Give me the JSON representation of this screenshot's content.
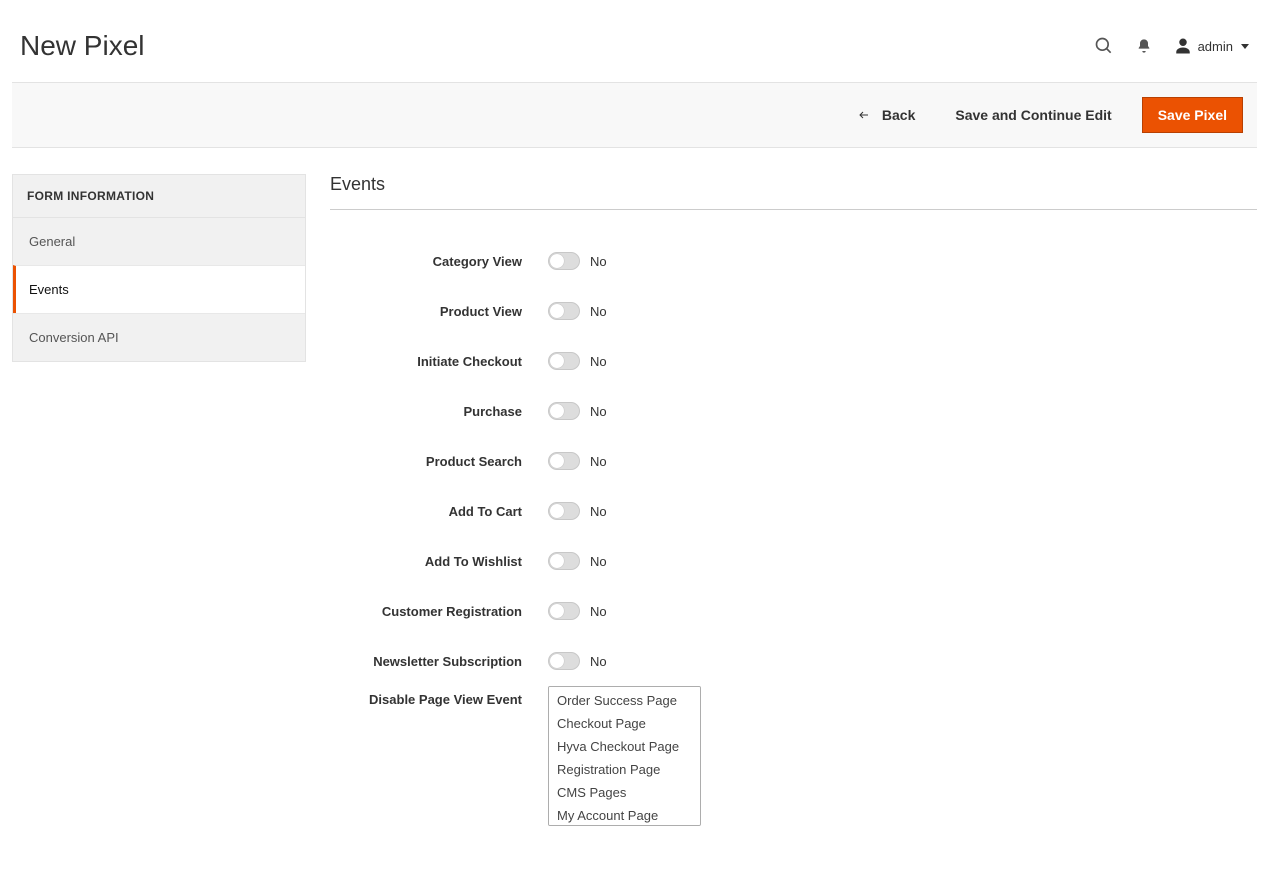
{
  "header": {
    "title": "New Pixel",
    "admin_label": "admin"
  },
  "actions": {
    "back": "Back",
    "save_continue": "Save and Continue Edit",
    "save": "Save Pixel"
  },
  "sidebar": {
    "header": "FORM INFORMATION",
    "items": [
      {
        "label": "General"
      },
      {
        "label": "Events"
      },
      {
        "label": "Conversion API"
      }
    ],
    "active_index": 1
  },
  "section": {
    "title": "Events"
  },
  "toggles": [
    {
      "label": "Category View",
      "value": "No"
    },
    {
      "label": "Product View",
      "value": "No"
    },
    {
      "label": "Initiate Checkout",
      "value": "No"
    },
    {
      "label": "Purchase",
      "value": "No"
    },
    {
      "label": "Product Search",
      "value": "No"
    },
    {
      "label": "Add To Cart",
      "value": "No"
    },
    {
      "label": "Add To Wishlist",
      "value": "No"
    },
    {
      "label": "Customer Registration",
      "value": "No"
    },
    {
      "label": "Newsletter Subscription",
      "value": "No"
    }
  ],
  "disable_page_view": {
    "label": "Disable Page View Event",
    "options": [
      "Order Success Page",
      "Checkout Page",
      "Hyva Checkout Page",
      "Registration Page",
      "CMS Pages",
      "My Account Page"
    ]
  }
}
